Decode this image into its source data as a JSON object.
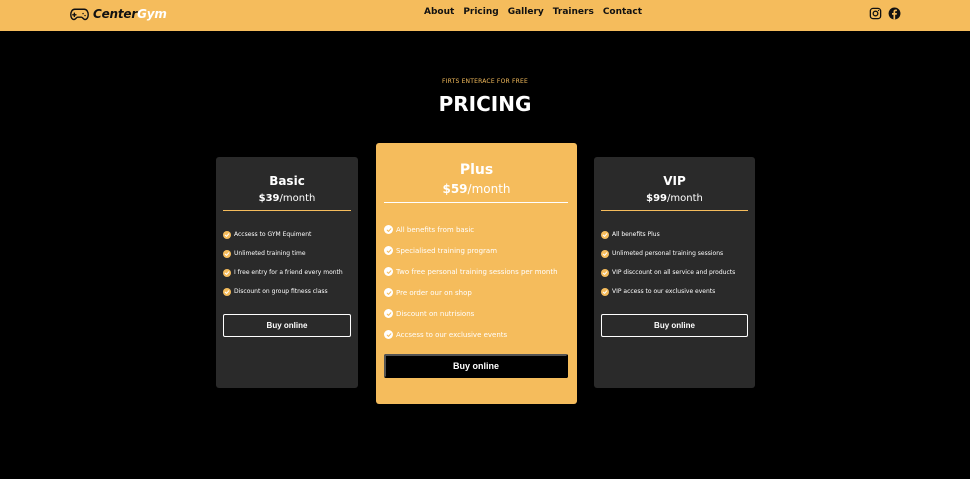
{
  "brand": {
    "name_dark": "Center",
    "name_accent": "Gym",
    "logo_icon": "gamepad-icon"
  },
  "nav": {
    "links": [
      "About",
      "Pricing",
      "Gallery",
      "Trainers",
      "Contact"
    ]
  },
  "socials": {
    "icons": [
      "instagram-icon",
      "facebook-icon"
    ]
  },
  "colors": {
    "accent": "#F5BC5C",
    "background": "#000000",
    "card": "#2a2a2a",
    "white": "#ffffff"
  },
  "pricing": {
    "eyebrow": "FIRTS ENTERACE FOR FREE",
    "title": "PRICING",
    "plans": [
      {
        "name": "Basic",
        "price": "$39",
        "period": "/month",
        "features": [
          "Accsess to GYM Equiment",
          "Unlimeted training time",
          "I free entry for a friend every month",
          "Discount on group fitness class"
        ],
        "button": "Buy online"
      },
      {
        "name": "Plus",
        "price": "$59",
        "period": "/month",
        "features": [
          "All benefits from basic",
          "Specialised training program",
          "Two free personal training sessions per month",
          "Pre order our on shop",
          "Discount on nutrisions",
          "Accsess to our exclusive events"
        ],
        "button": "Buy online"
      },
      {
        "name": "VIP",
        "price": "$99",
        "period": "/month",
        "features": [
          "All benefits Plus",
          "Unlimeted personal training sessions",
          "VIP disccount on all service and products",
          "VIP access to our exclusive events"
        ],
        "button": "Buy online"
      }
    ]
  }
}
